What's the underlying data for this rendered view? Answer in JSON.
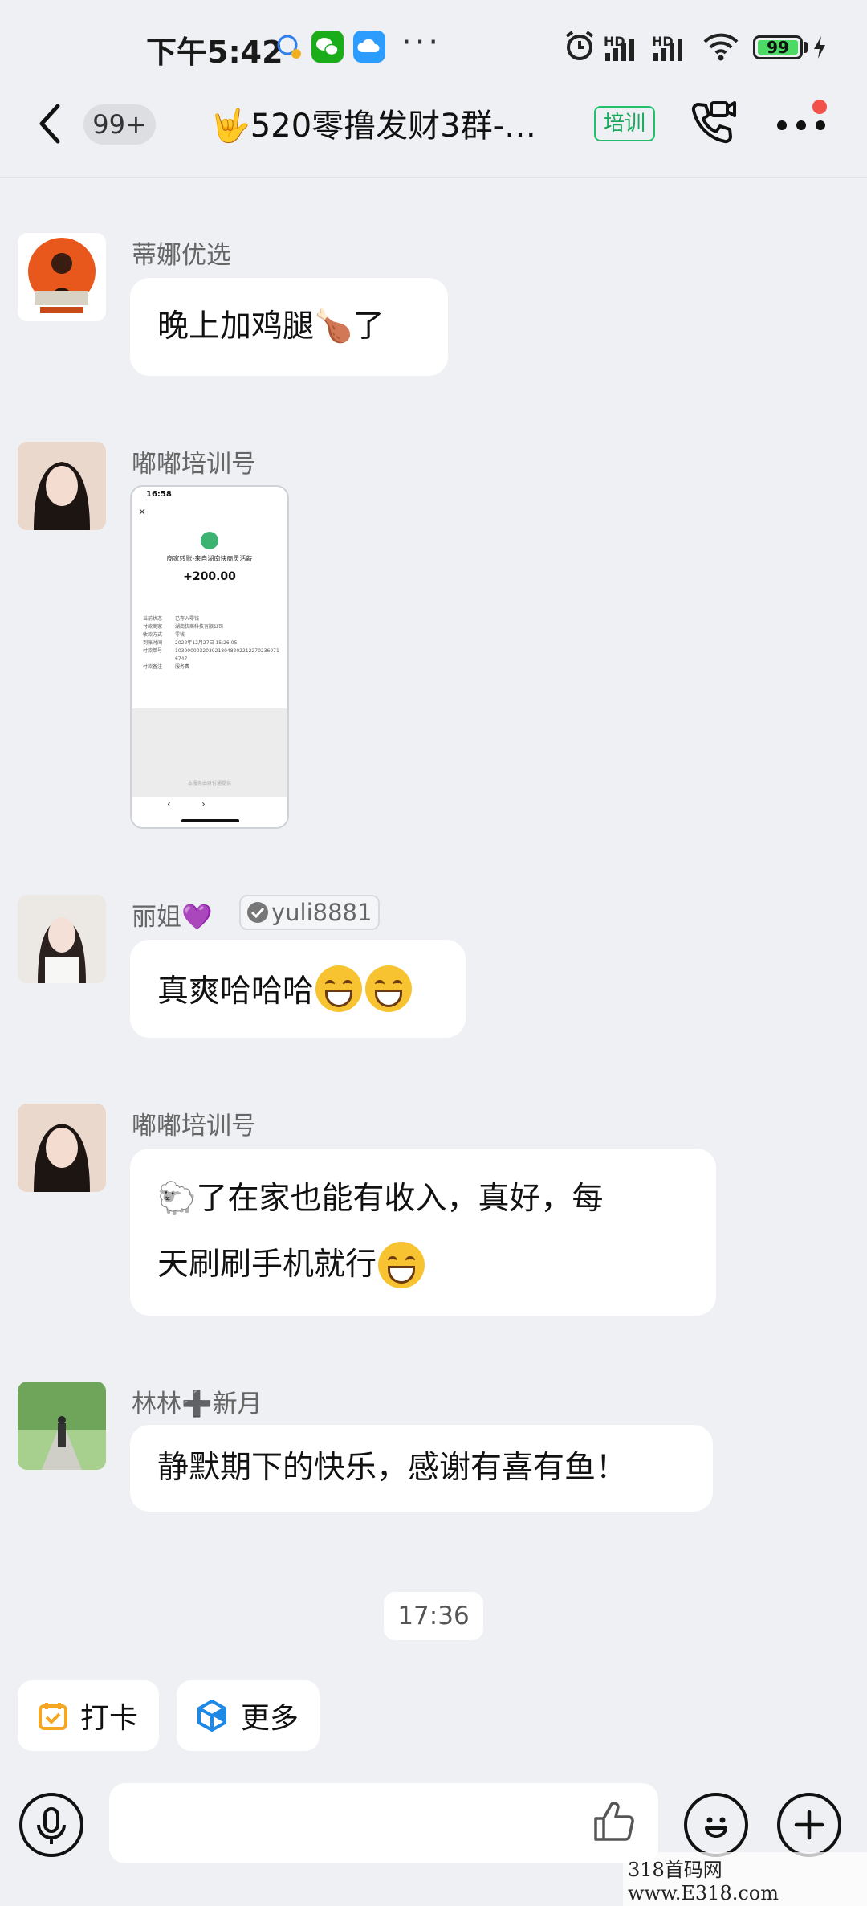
{
  "status_bar": {
    "time": "下午5:42",
    "battery": "99",
    "network_a": "HD",
    "network_b": "HD"
  },
  "header": {
    "unread_count": "99+",
    "title": "🤟520零撸发财3群-…",
    "tag": "培训"
  },
  "messages": [
    {
      "sender": "蒂娜优选",
      "text": "晚上加鸡腿🍗了"
    },
    {
      "sender": "嘟嘟培训号",
      "image": {
        "time": "16:58",
        "merchant": "商家转账-来自湖南快商灵活薪",
        "amount": "+200.00",
        "rows": [
          {
            "label": "当前状态",
            "value": "已存入零钱"
          },
          {
            "label": "付款商家",
            "value": "湖南快商科技有限公司"
          },
          {
            "label": "收款方式",
            "value": "零钱"
          },
          {
            "label": "到账时间",
            "value": "2022年12月27日 15:26:05"
          },
          {
            "label": "付款单号",
            "value": "1030000032030218048202212270236071674​7"
          },
          {
            "label": "付款备注",
            "value": "服务费"
          }
        ],
        "footer": "本服务由财付通提供"
      }
    },
    {
      "sender": "丽姐💜",
      "badge": "yuli8881",
      "text": "真爽哈哈哈"
    },
    {
      "sender": "嘟嘟培训号",
      "text_line1": "🐑了在家也能有收入，真好，每",
      "text_line2": "天刷刷手机就行"
    },
    {
      "sender": "林林➕新月",
      "text": "静默期下的快乐，感谢有喜有鱼！"
    }
  ],
  "time_divider": "17:36",
  "quick_actions": {
    "checkin": "打卡",
    "more": "更多"
  },
  "input": {
    "placeholder": ""
  },
  "watermark": "318首码网 www.E318.com",
  "colors": {
    "background": "#eef0f3",
    "tag_green": "#18a85d",
    "battery_green": "#4cd964"
  }
}
